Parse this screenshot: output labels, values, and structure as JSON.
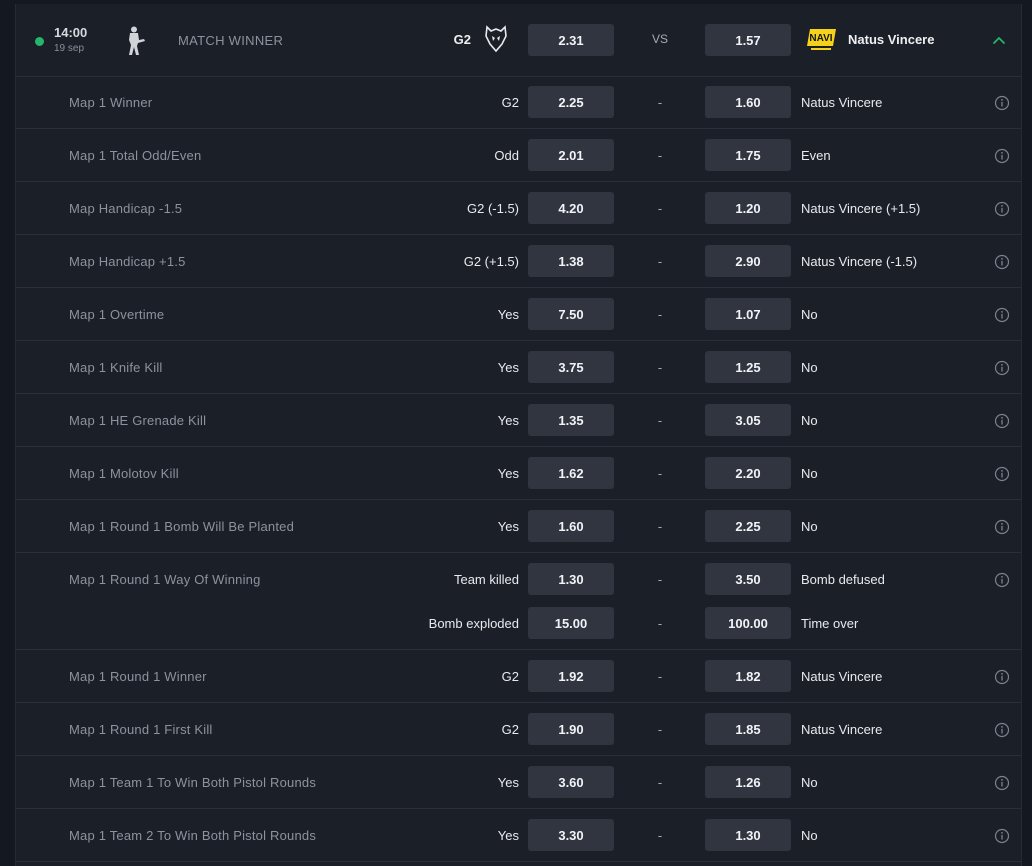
{
  "match": {
    "time": "14:00",
    "date": "19 sep",
    "market_type": "MATCH WINNER",
    "team1": "G2",
    "team2": "Natus Vincere",
    "vs": "VS",
    "odd1": "2.31",
    "odd2": "1.57",
    "status_color": "#25b56b",
    "game_icon": "counter-strike-soldier-icon",
    "collapse_icon": "chevron-up-icon"
  },
  "markets": [
    {
      "name": "Map 1 Winner",
      "lines": [
        {
          "sel1": "G2",
          "odd1": "2.25",
          "sep": "-",
          "odd2": "1.60",
          "sel2": "Natus Vincere"
        }
      ]
    },
    {
      "name": "Map 1 Total Odd/Even",
      "lines": [
        {
          "sel1": "Odd",
          "odd1": "2.01",
          "sep": "-",
          "odd2": "1.75",
          "sel2": "Even"
        }
      ]
    },
    {
      "name": "Map Handicap -1.5",
      "lines": [
        {
          "sel1": "G2 (-1.5)",
          "odd1": "4.20",
          "sep": "-",
          "odd2": "1.20",
          "sel2": "Natus Vincere (+1.5)"
        }
      ]
    },
    {
      "name": "Map Handicap +1.5",
      "lines": [
        {
          "sel1": "G2 (+1.5)",
          "odd1": "1.38",
          "sep": "-",
          "odd2": "2.90",
          "sel2": "Natus Vincere (-1.5)"
        }
      ]
    },
    {
      "name": "Map 1 Overtime",
      "lines": [
        {
          "sel1": "Yes",
          "odd1": "7.50",
          "sep": "-",
          "odd2": "1.07",
          "sel2": "No"
        }
      ]
    },
    {
      "name": "Map 1 Knife Kill",
      "lines": [
        {
          "sel1": "Yes",
          "odd1": "3.75",
          "sep": "-",
          "odd2": "1.25",
          "sel2": "No"
        }
      ]
    },
    {
      "name": "Map 1 HE Grenade Kill",
      "lines": [
        {
          "sel1": "Yes",
          "odd1": "1.35",
          "sep": "-",
          "odd2": "3.05",
          "sel2": "No"
        }
      ]
    },
    {
      "name": "Map 1 Molotov Kill",
      "lines": [
        {
          "sel1": "Yes",
          "odd1": "1.62",
          "sep": "-",
          "odd2": "2.20",
          "sel2": "No"
        }
      ]
    },
    {
      "name": "Map 1 Round 1 Bomb Will Be Planted",
      "lines": [
        {
          "sel1": "Yes",
          "odd1": "1.60",
          "sep": "-",
          "odd2": "2.25",
          "sel2": "No"
        }
      ]
    },
    {
      "name": "Map 1 Round 1 Way Of Winning",
      "lines": [
        {
          "sel1": "Team killed",
          "odd1": "1.30",
          "sep": "-",
          "odd2": "3.50",
          "sel2": "Bomb defused"
        },
        {
          "sel1": "Bomb exploded",
          "odd1": "15.00",
          "sep": "-",
          "odd2": "100.00",
          "sel2": "Time over"
        }
      ]
    },
    {
      "name": "Map 1 Round 1 Winner",
      "lines": [
        {
          "sel1": "G2",
          "odd1": "1.92",
          "sep": "-",
          "odd2": "1.82",
          "sel2": "Natus Vincere"
        }
      ]
    },
    {
      "name": "Map 1 Round 1 First Kill",
      "lines": [
        {
          "sel1": "G2",
          "odd1": "1.90",
          "sep": "-",
          "odd2": "1.85",
          "sel2": "Natus Vincere"
        }
      ]
    },
    {
      "name": "Map 1 Team 1 To Win Both Pistol Rounds",
      "lines": [
        {
          "sel1": "Yes",
          "odd1": "3.60",
          "sep": "-",
          "odd2": "1.26",
          "sel2": "No"
        }
      ]
    },
    {
      "name": "Map 1 Team 2 To Win Both Pistol Rounds",
      "lines": [
        {
          "sel1": "Yes",
          "odd1": "3.30",
          "sep": "-",
          "odd2": "1.30",
          "sel2": "No"
        }
      ]
    }
  ]
}
